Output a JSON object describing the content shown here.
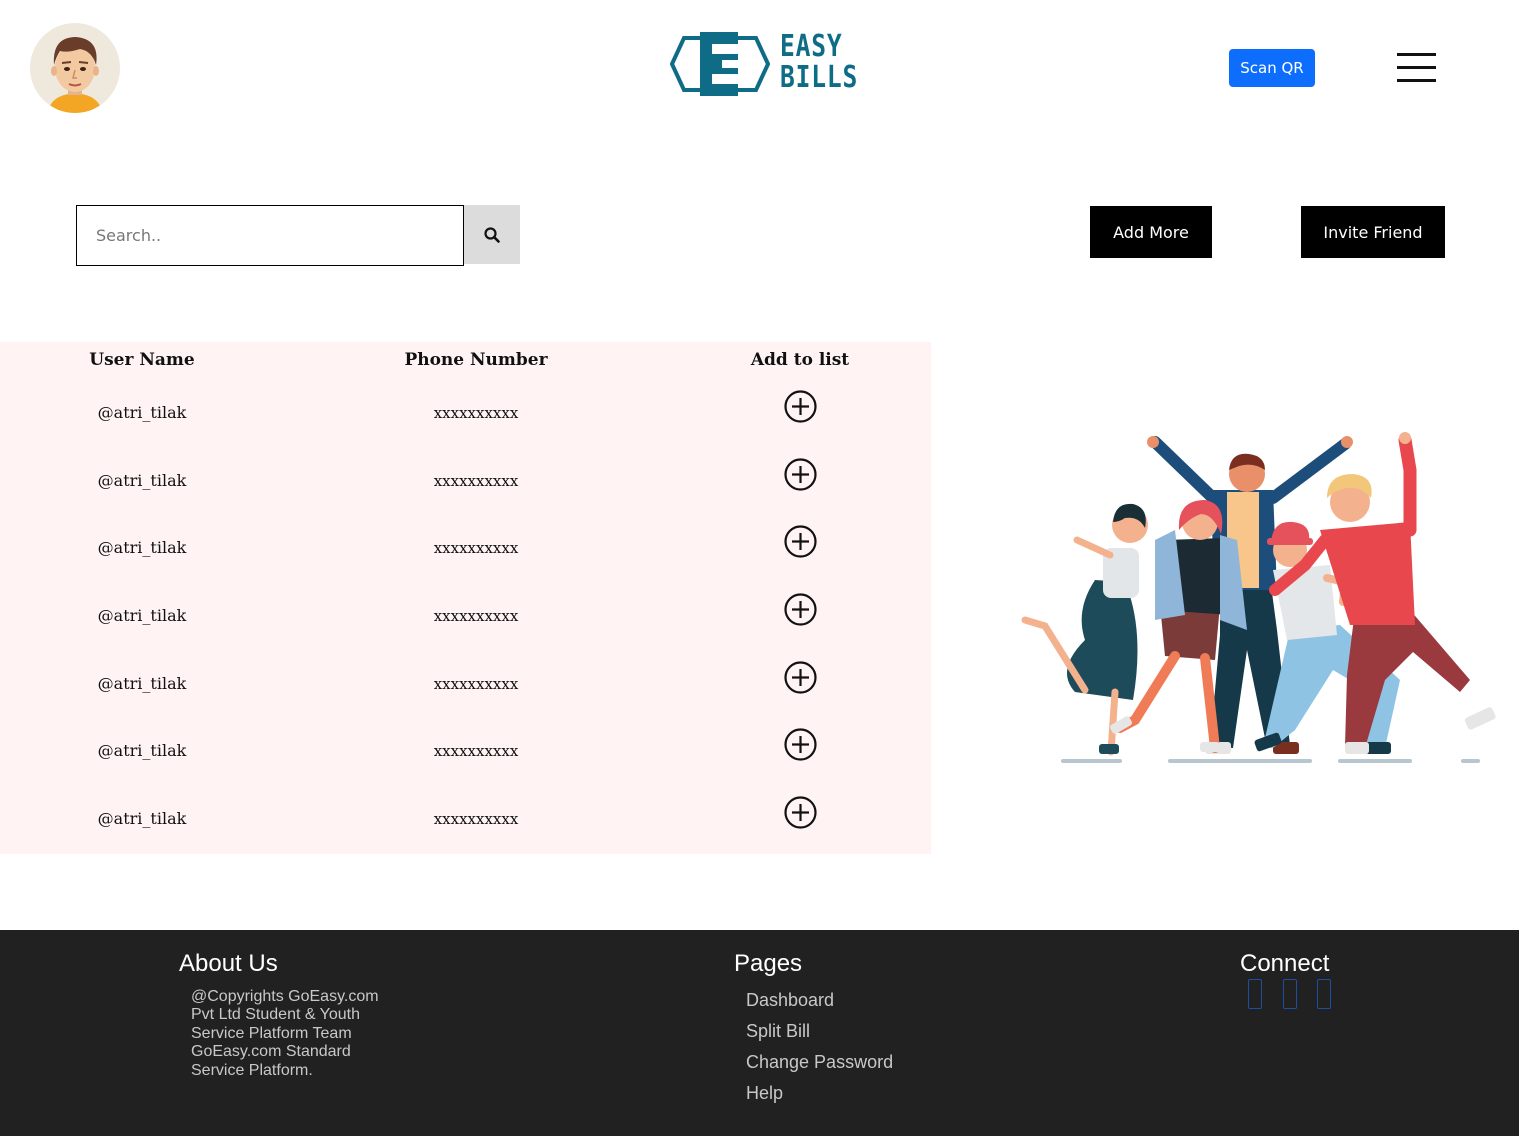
{
  "header": {
    "logo_line1": "EASY",
    "logo_line2": "BILLS",
    "logo_letter": "E",
    "scan_label": "Scan QR"
  },
  "toolbar": {
    "search_placeholder": "Search..",
    "add_more_label": "Add More",
    "invite_label": "Invite Friend"
  },
  "table": {
    "headers": [
      "User Name",
      "Phone Number",
      "Add to list"
    ],
    "rows": [
      {
        "user": "@atri_tilak",
        "phone": "xxxxxxxxxx"
      },
      {
        "user": "@atri_tilak",
        "phone": "xxxxxxxxxx"
      },
      {
        "user": "@atri_tilak",
        "phone": "xxxxxxxxxx"
      },
      {
        "user": "@atri_tilak",
        "phone": "xxxxxxxxxx"
      },
      {
        "user": "@atri_tilak",
        "phone": "xxxxxxxxxx"
      },
      {
        "user": "@atri_tilak",
        "phone": "xxxxxxxxxx"
      },
      {
        "user": "@atri_tilak",
        "phone": "xxxxxxxxxx"
      }
    ]
  },
  "footer": {
    "about_title": "About Us",
    "about_text": "@Copyrights GoEasy.com Pvt Ltd Student & Youth Service Platform Team GoEasy.com Standard Service Platform.",
    "pages_title": "Pages",
    "pages": [
      "Dashboard",
      "Split Bill",
      "Change Password",
      "Help"
    ],
    "connect_title": "Connect"
  },
  "colors": {
    "brand": "#0f6c86",
    "primary_button": "#0d6efd",
    "table_bg": "#fff4f3",
    "footer_bg": "#212121"
  },
  "icons": [
    "user-avatar",
    "search-icon",
    "hamburger-menu-icon",
    "plus-circle-icon",
    "social-icon"
  ]
}
